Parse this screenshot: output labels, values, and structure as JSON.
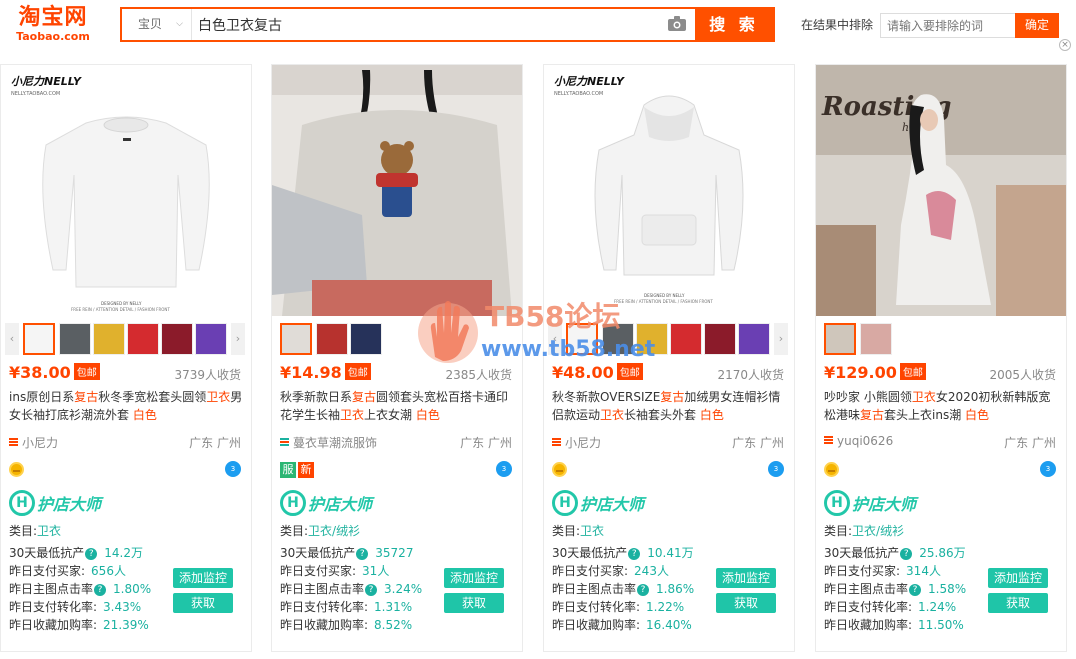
{
  "header": {
    "logo_zh": "淘宝网",
    "logo_en": "Taobao.com",
    "category": "宝贝",
    "query": "白色卫衣复古",
    "search_label": "搜 索",
    "exclude_label": "在结果中排除",
    "exclude_placeholder": "请输入要排除的词",
    "exclude_confirm": "确定"
  },
  "watermark": {
    "line1": "TB58论坛",
    "line2": "www.tb58.net"
  },
  "products": [
    {
      "price": "¥38.00",
      "baoyou": "包邮",
      "sold": "3739人收货",
      "title_parts": [
        "ins原创日系",
        "复古",
        "秋冬季宽松套头圆领",
        "卫衣",
        "男女长袖打底衫潮流外套 ",
        "白色"
      ],
      "shop": "小尼力",
      "location": "广东 广州",
      "category_label": "类目:",
      "category": "卫衣",
      "stats": [
        {
          "label": "30天最低抗产",
          "value": "14.2万"
        },
        {
          "label": "昨日支付买家:",
          "value": "656人"
        },
        {
          "label": "昨日主图点击率",
          "value": "1.80%"
        },
        {
          "label": "昨日支付转化率:",
          "value": "3.43%"
        },
        {
          "label": "昨日收藏加购率:",
          "value": "21.39%"
        }
      ]
    },
    {
      "price": "¥14.98",
      "baoyou": "包邮",
      "sold": "2385人收货",
      "title_parts": [
        "秋季新款日系",
        "复古",
        "圆领套头宽松百搭卡通印花学生长袖",
        "卫衣",
        "上衣女潮 ",
        "白色"
      ],
      "shop": "蔓衣草潮流服饰",
      "location": "广东 广州",
      "category_label": "类目:",
      "category": "卫衣/绒衫",
      "tag1": "服",
      "tag2": "新",
      "stats": [
        {
          "label": "30天最低抗产",
          "value": "35727"
        },
        {
          "label": "昨日支付买家:",
          "value": "31人"
        },
        {
          "label": "昨日主图点击率",
          "value": "3.24%"
        },
        {
          "label": "昨日支付转化率:",
          "value": "1.31%"
        },
        {
          "label": "昨日收藏加购率:",
          "value": "8.52%"
        }
      ]
    },
    {
      "price": "¥48.00",
      "baoyou": "包邮",
      "sold": "2170人收货",
      "title_parts": [
        "秋冬新款OVERSIZE",
        "复古",
        "加绒男女连帽衫情侣款运动",
        "卫衣",
        "长袖套头外套 ",
        "白色"
      ],
      "shop": "小尼力",
      "location": "广东 广州",
      "category_label": "类目:",
      "category": "卫衣",
      "stats": [
        {
          "label": "30天最低抗产",
          "value": "10.41万"
        },
        {
          "label": "昨日支付买家:",
          "value": "243人"
        },
        {
          "label": "昨日主图点击率",
          "value": "1.86%"
        },
        {
          "label": "昨日支付转化率:",
          "value": "1.22%"
        },
        {
          "label": "昨日收藏加购率:",
          "value": "16.40%"
        }
      ]
    },
    {
      "price": "¥129.00",
      "baoyou": "包邮",
      "sold": "2005人收货",
      "title_parts": [
        "吵吵家 小熊圆领",
        "卫衣",
        "女2020初秋新韩版宽松港味",
        "复古",
        "套头上衣ins潮 ",
        "白色"
      ],
      "shop": "yuqi0626",
      "location": "广东 广州",
      "category_label": "类目:",
      "category": "卫衣/绒衫",
      "stats": [
        {
          "label": "30天最低抗产",
          "value": "25.86万"
        },
        {
          "label": "昨日支付买家:",
          "value": "314人"
        },
        {
          "label": "昨日主图点击率",
          "value": "1.58%"
        },
        {
          "label": "昨日支付转化率:",
          "value": "1.24%"
        },
        {
          "label": "昨日收藏加购率:",
          "value": "11.50%"
        }
      ]
    }
  ],
  "brand_pic": {
    "logo": "小尼力NELLY",
    "sub": "NELLY.TAOBAO.COM",
    "foot1": "DESIGNED BY NELLY",
    "foot2": "FREE REIN / ATTENTION DETAIL / FASHION FRONT",
    "cafe": "Roasting",
    "cafe2": "hand"
  },
  "common": {
    "hdm": "护店大师",
    "monitor": "添加监控",
    "get": "获取",
    "wang": "3"
  }
}
